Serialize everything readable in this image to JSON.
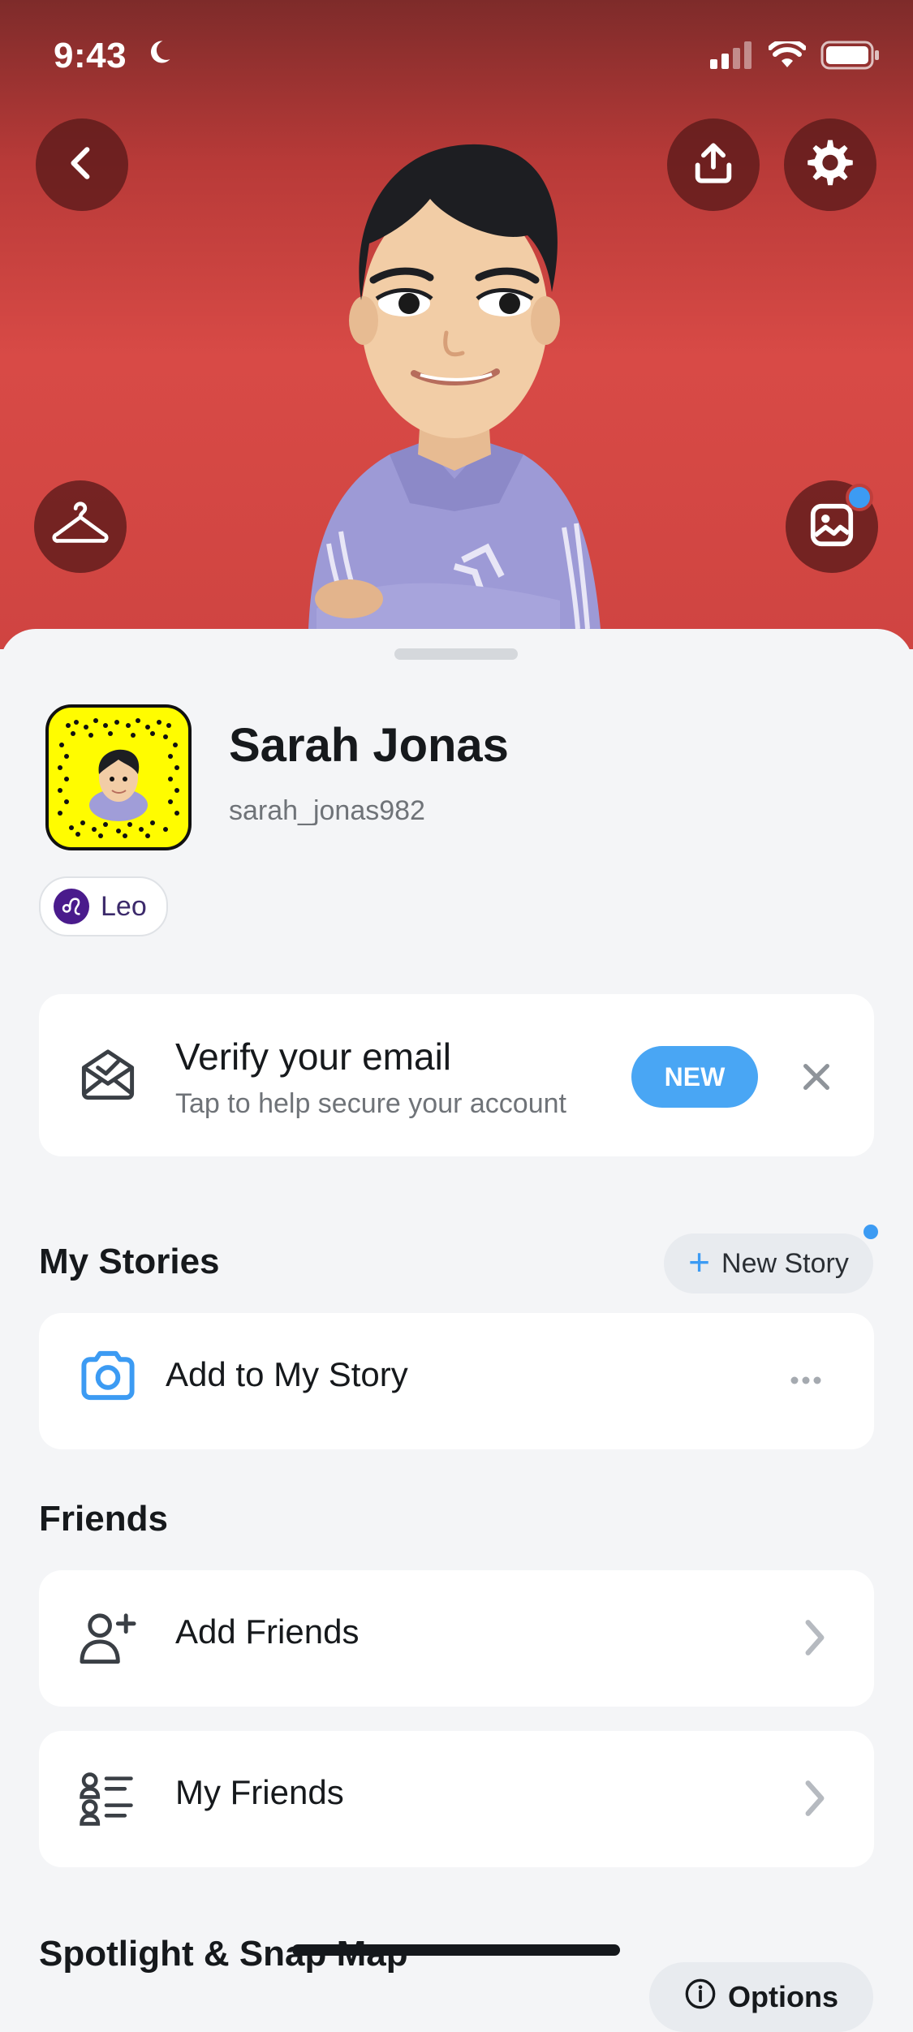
{
  "status_bar": {
    "time": "9:43"
  },
  "profile": {
    "display_name": "Sarah Jonas",
    "username": "sarah_jonas982",
    "zodiac": "Leo"
  },
  "verify_card": {
    "title": "Verify your email",
    "subtitle": "Tap to help secure your account",
    "badge": "NEW"
  },
  "my_stories": {
    "section_title": "My Stories",
    "new_story_label": "New Story",
    "add_story_label": "Add to My Story"
  },
  "friends": {
    "section_title": "Friends",
    "items": [
      {
        "label": "Add Friends"
      },
      {
        "label": "My Friends"
      }
    ]
  },
  "spotlight": {
    "section_title": "Spotlight & Snap Map",
    "options_label": "Options"
  },
  "colors": {
    "hero_red": "#d84a46",
    "accent_blue": "#3c9bf3",
    "snapcode_yellow": "#fffc00"
  },
  "icons": [
    "back-icon",
    "share-icon",
    "settings-icon",
    "hanger-icon",
    "gallery-icon",
    "mail-check-icon",
    "close-icon",
    "camera-icon",
    "more-icon",
    "add-friend-icon",
    "friend-list-icon",
    "chevron-right-icon",
    "info-icon",
    "leo-icon",
    "moon-icon",
    "signal-icon",
    "wifi-icon",
    "battery-icon"
  ]
}
